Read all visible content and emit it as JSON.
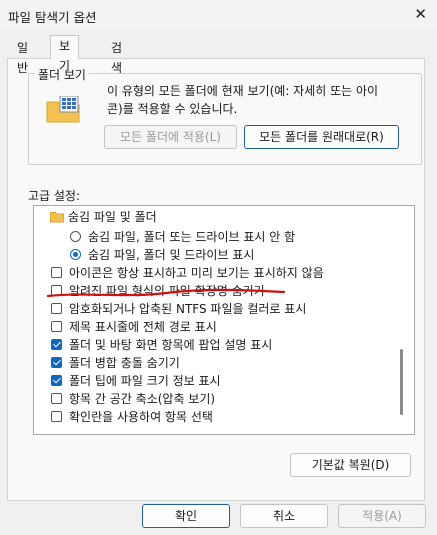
{
  "window": {
    "title": "파일 탐색기 옵션",
    "close_glyph": "✕"
  },
  "tabs": [
    {
      "label": "일반",
      "active": false
    },
    {
      "label": "보기",
      "active": true
    },
    {
      "label": "검색",
      "active": false
    }
  ],
  "folder_view": {
    "legend": "폴더 보기",
    "description_line1": "이 유형의 모든 폴더에 현재 보기(예: 자세히 또는 아이",
    "description_line2": "콘)를 적용할 수 있습니다.",
    "apply_button": "모든 폴더에 적용(L)",
    "reset_button": "모든 폴더를 원래대로(R)"
  },
  "advanced": {
    "label": "고급 설정:",
    "items": [
      {
        "type": "folder",
        "label": "숨김 파일 및 폴더"
      },
      {
        "type": "radio",
        "checked": false,
        "label": "숨김 파일, 폴더 또는 드라이브 표시 안 함"
      },
      {
        "type": "radio",
        "checked": true,
        "label": "숨김 파일, 폴더 및 드라이브 표시"
      },
      {
        "type": "checkbox",
        "checked": false,
        "label": "아이콘은 항상 표시하고 미리 보기는 표시하지 않음"
      },
      {
        "type": "checkbox",
        "checked": false,
        "label": "알려진 파일 형식의 파일 확장명 숨기기"
      },
      {
        "type": "checkbox",
        "checked": false,
        "label": "암호화되거나 압축된 NTFS 파일을 컬러로 표시"
      },
      {
        "type": "checkbox",
        "checked": false,
        "label": "제목 표시줄에 전체 경로 표시"
      },
      {
        "type": "checkbox",
        "checked": true,
        "label": "폴더 및 바탕 화면 항목에 팝업 설명 표시"
      },
      {
        "type": "checkbox",
        "checked": true,
        "label": "폴더 병합 충돌 숨기기"
      },
      {
        "type": "checkbox",
        "checked": true,
        "label": "폴더 팁에 파일 크기 정보 표시"
      },
      {
        "type": "checkbox",
        "checked": false,
        "label": "항목 간 공간 축소(압축 보기)"
      },
      {
        "type": "checkbox",
        "checked": false,
        "label": "확인란을 사용하여 항목 선택"
      }
    ],
    "restore_defaults_button": "기본값 복원(D)"
  },
  "footer": {
    "ok": "확인",
    "cancel": "취소",
    "apply": "적용(A)"
  },
  "colors": {
    "accent": "#0f67c2",
    "annotation": "#d01010"
  }
}
